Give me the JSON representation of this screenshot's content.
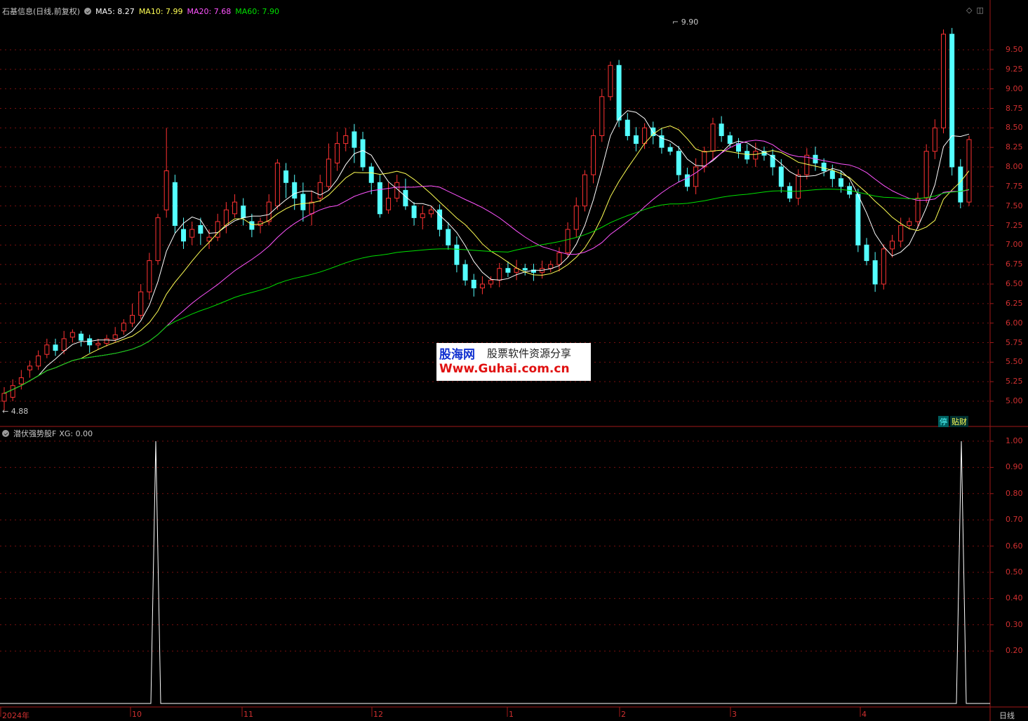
{
  "header": {
    "stock_name": "石基信息(日线,前复权)",
    "ma5": "MA5: 8.27",
    "ma10": "MA10: 7.99",
    "ma20": "MA20: 7.68",
    "ma60": "MA60: 7.90"
  },
  "indicator_header": {
    "name": "潜伏强势股F",
    "xg": "XG: 0.00"
  },
  "price_axis": [
    "9.50",
    "9.25",
    "9.00",
    "8.75",
    "8.50",
    "8.25",
    "8.00",
    "7.75",
    "7.50",
    "7.25",
    "7.00",
    "6.75",
    "6.50",
    "6.25",
    "6.00",
    "5.75",
    "5.50",
    "5.25",
    "5.00"
  ],
  "ind_axis": [
    "1.00",
    "0.90",
    "0.80",
    "0.70",
    "0.60",
    "0.50",
    "0.40",
    "0.30",
    "0.20"
  ],
  "x_labels": [
    "2024年",
    "10",
    "11",
    "12",
    "1",
    "2",
    "3",
    "4"
  ],
  "period_label": "日线",
  "high_label": "9.90",
  "low_label": "4.88",
  "tags": {
    "ting": "停",
    "tiecai": "贴财"
  },
  "watermark": {
    "brand": "股海网",
    "slogan": "股票软件资源分享",
    "url": "Www.Guhai.com.cn"
  },
  "colors": {
    "up": "#ff3232",
    "down": "#54ffff",
    "ma5": "#ffffff",
    "ma10": "#ffff54",
    "ma20": "#ff54ff",
    "ma60": "#00e000",
    "grid": "#7a1010"
  },
  "chart_data": {
    "type": "candlestick",
    "price_range": [
      4.88,
      9.9
    ],
    "candles_ohlc": [
      [
        5.0,
        5.1,
        4.88,
        5.18
      ],
      [
        5.05,
        5.2,
        5.0,
        5.28
      ],
      [
        5.22,
        5.3,
        5.15,
        5.4
      ],
      [
        5.4,
        5.45,
        5.3,
        5.52
      ],
      [
        5.45,
        5.58,
        5.4,
        5.65
      ],
      [
        5.6,
        5.72,
        5.55,
        5.8
      ],
      [
        5.72,
        5.65,
        5.58,
        5.8
      ],
      [
        5.65,
        5.8,
        5.6,
        5.9
      ],
      [
        5.82,
        5.88,
        5.75,
        5.92
      ],
      [
        5.86,
        5.78,
        5.7,
        5.9
      ],
      [
        5.8,
        5.72,
        5.62,
        5.85
      ],
      [
        5.72,
        5.74,
        5.66,
        5.8
      ],
      [
        5.74,
        5.8,
        5.7,
        5.85
      ],
      [
        5.8,
        5.85,
        5.75,
        5.95
      ],
      [
        5.9,
        6.0,
        5.85,
        6.05
      ],
      [
        6.0,
        6.1,
        5.95,
        6.25
      ],
      [
        6.1,
        6.4,
        6.05,
        6.5
      ],
      [
        6.4,
        6.8,
        6.3,
        6.9
      ],
      [
        6.8,
        7.35,
        6.75,
        7.4
      ],
      [
        7.45,
        7.95,
        7.35,
        8.5
      ],
      [
        7.8,
        7.25,
        7.15,
        7.9
      ],
      [
        7.2,
        7.05,
        6.95,
        7.35
      ],
      [
        7.1,
        7.2,
        7.0,
        7.3
      ],
      [
        7.25,
        7.15,
        7.0,
        7.35
      ],
      [
        7.05,
        7.1,
        6.95,
        7.2
      ],
      [
        7.1,
        7.3,
        7.05,
        7.4
      ],
      [
        7.25,
        7.45,
        7.15,
        7.55
      ],
      [
        7.4,
        7.55,
        7.35,
        7.65
      ],
      [
        7.5,
        7.35,
        7.25,
        7.6
      ],
      [
        7.3,
        7.2,
        7.1,
        7.4
      ],
      [
        7.25,
        7.3,
        7.15,
        7.35
      ],
      [
        7.3,
        7.55,
        7.25,
        7.65
      ],
      [
        7.5,
        8.05,
        7.45,
        8.1
      ],
      [
        7.95,
        7.8,
        7.6,
        8.05
      ],
      [
        7.8,
        7.6,
        7.45,
        7.9
      ],
      [
        7.65,
        7.45,
        7.3,
        7.8
      ],
      [
        7.4,
        7.55,
        7.25,
        7.7
      ],
      [
        7.6,
        7.8,
        7.55,
        7.9
      ],
      [
        7.75,
        8.1,
        7.7,
        8.3
      ],
      [
        8.05,
        8.3,
        7.95,
        8.45
      ],
      [
        8.3,
        8.4,
        8.2,
        8.5
      ],
      [
        8.45,
        8.25,
        8.05,
        8.55
      ],
      [
        8.35,
        8.0,
        7.95,
        8.45
      ],
      [
        8.0,
        7.8,
        7.65,
        8.05
      ],
      [
        7.8,
        7.4,
        7.35,
        7.9
      ],
      [
        7.45,
        7.6,
        7.4,
        7.8
      ],
      [
        7.6,
        7.8,
        7.55,
        7.9
      ],
      [
        7.7,
        7.5,
        7.45,
        7.85
      ],
      [
        7.5,
        7.35,
        7.25,
        7.55
      ],
      [
        7.35,
        7.4,
        7.2,
        7.5
      ]
    ]
  }
}
